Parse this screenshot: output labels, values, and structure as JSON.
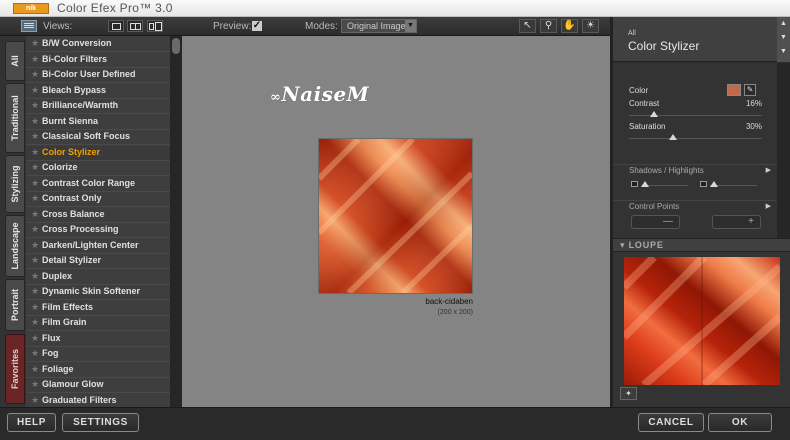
{
  "window": {
    "title": "Color Efex Pro™ 3.0",
    "logo_text": "nik Software"
  },
  "toolbar": {
    "views_label": "Views:",
    "preview_label": "Preview:",
    "preview_checked": "✓",
    "modes_label": "Modes:",
    "mode_value": "Original Image",
    "icons": [
      "pointer-icon",
      "zoom-icon",
      "hand-icon",
      "bulb-icon"
    ]
  },
  "tabs": [
    {
      "label": "All"
    },
    {
      "label": "Traditional"
    },
    {
      "label": "Stylizing"
    },
    {
      "label": "Landscape"
    },
    {
      "label": "Portrait"
    },
    {
      "label": "Favorites"
    }
  ],
  "filters": {
    "selected": "Color Stylizer",
    "items": [
      "B/W Conversion",
      "Bi-Color Filters",
      "Bi-Color User Defined",
      "Bleach Bypass",
      "Brilliance/Warmth",
      "Burnt Sienna",
      "Classical Soft Focus",
      "Color Stylizer",
      "Colorize",
      "Contrast Color Range",
      "Contrast Only",
      "Cross Balance",
      "Cross Processing",
      "Darken/Lighten Center",
      "Detail Stylizer",
      "Duplex",
      "Dynamic Skin Softener",
      "Film Effects",
      "Film Grain",
      "Flux",
      "Fog",
      "Foliage",
      "Glamour Glow",
      "Graduated Filters"
    ]
  },
  "canvas": {
    "watermark": "NaiseM",
    "image_name": "back-cidaben",
    "image_size": "(200 x 200)"
  },
  "panel": {
    "category": "All",
    "filter_title": "Color Stylizer",
    "color_label": "Color",
    "color_swatch": "#c4684a",
    "contrast_label": "Contrast",
    "contrast_value": "16%",
    "contrast_level": 0.16,
    "saturation_label": "Saturation",
    "saturation_value": "30%",
    "saturation_level": 0.3,
    "shadows_label": "Shadows / Highlights",
    "control_points_label": "Control Points",
    "loupe_label": "LOUPE"
  },
  "bottom": {
    "help": "HELP",
    "settings": "SETTINGS",
    "cancel": "CANCEL",
    "ok": "OK"
  }
}
